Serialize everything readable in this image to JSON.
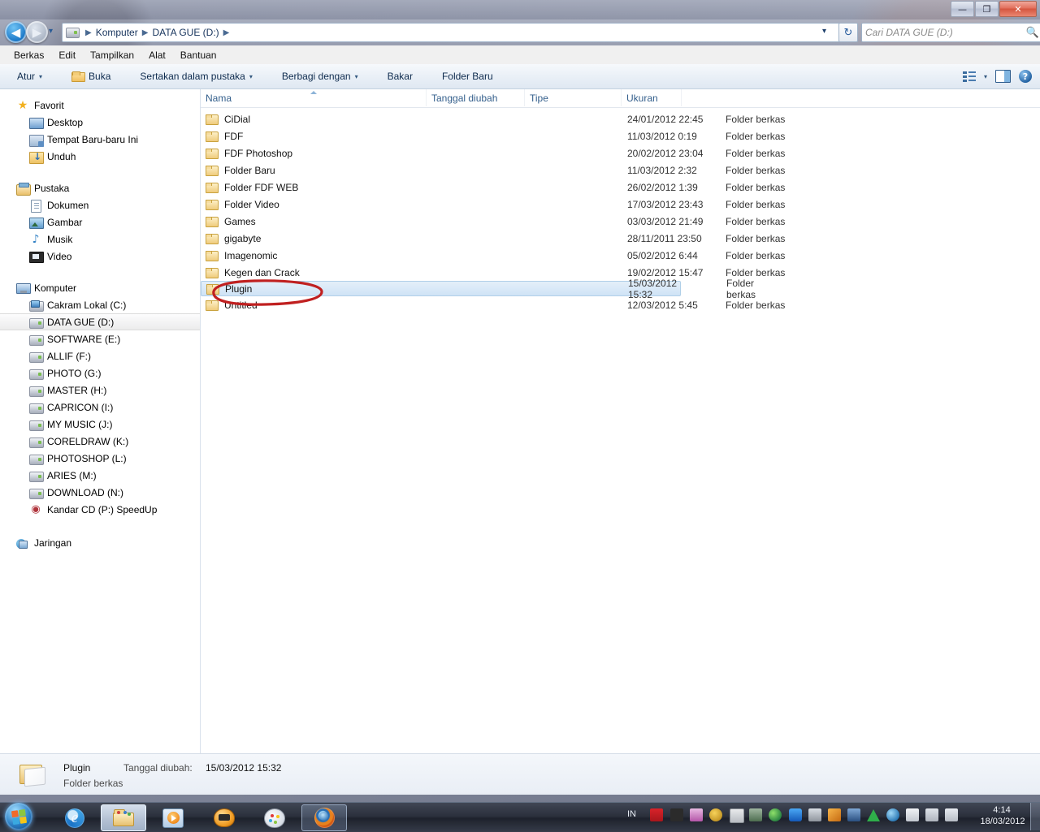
{
  "window": {
    "title_bar_buttons": {
      "minimize": "—",
      "maximize": "❐",
      "close": "✕"
    }
  },
  "address_bar": {
    "back_glyph": "◀",
    "forward_glyph": "▶",
    "history_glyph": "▾",
    "refresh_glyph": "↻",
    "crumb_separator": "▶",
    "breadcrumbs": [
      "Komputer",
      "DATA GUE (D:)"
    ],
    "drive_icon": "drive-icon"
  },
  "search": {
    "placeholder": "Cari DATA GUE (D:)",
    "icon": "search-icon",
    "glyph": "🔍"
  },
  "menu": {
    "items": [
      "Berkas",
      "Edit",
      "Tampilkan",
      "Alat",
      "Bantuan"
    ]
  },
  "command_bar": {
    "organize": "Atur",
    "open": "Buka",
    "include_library": "Sertakan dalam pustaka",
    "share_with": "Berbagi dengan",
    "burn": "Bakar",
    "new_folder": "Folder Baru",
    "caret": "▾",
    "view_icon": "view-options-icon",
    "preview_pane_icon": "preview-pane-icon",
    "help_icon": "help-icon",
    "help_glyph": "?"
  },
  "sidebar": {
    "groups": [
      {
        "name": "Favorit",
        "icon": "star-icon",
        "glyph": "★",
        "items": [
          {
            "label": "Desktop",
            "icon": "desktop-icon"
          },
          {
            "label": "Tempat Baru-baru Ini",
            "icon": "recent-places-icon"
          },
          {
            "label": "Unduh",
            "icon": "downloads-icon"
          }
        ]
      },
      {
        "name": "Pustaka",
        "icon": "library-icon",
        "items": [
          {
            "label": "Dokumen",
            "icon": "documents-icon"
          },
          {
            "label": "Gambar",
            "icon": "pictures-icon"
          },
          {
            "label": "Musik",
            "icon": "music-icon",
            "glyph": "♪"
          },
          {
            "label": "Video",
            "icon": "video-icon"
          }
        ]
      },
      {
        "name": "Komputer",
        "icon": "computer-icon",
        "items": [
          {
            "label": "Cakram Lokal (C:)",
            "icon": "system-drive-icon",
            "selected": false
          },
          {
            "label": "DATA GUE (D:)",
            "icon": "drive-icon",
            "selected": true
          },
          {
            "label": "SOFTWARE (E:)",
            "icon": "drive-icon",
            "selected": false
          },
          {
            "label": "ALLIF (F:)",
            "icon": "drive-icon",
            "selected": false
          },
          {
            "label": "PHOTO (G:)",
            "icon": "drive-icon",
            "selected": false
          },
          {
            "label": "MASTER (H:)",
            "icon": "drive-icon",
            "selected": false
          },
          {
            "label": "CAPRICON (I:)",
            "icon": "drive-icon",
            "selected": false
          },
          {
            "label": "MY MUSIC (J:)",
            "icon": "drive-icon",
            "selected": false
          },
          {
            "label": "CORELDRAW (K:)",
            "icon": "drive-icon",
            "selected": false
          },
          {
            "label": "PHOTOSHOP (L:)",
            "icon": "drive-icon",
            "selected": false
          },
          {
            "label": "ARIES (M:)",
            "icon": "drive-icon",
            "selected": false
          },
          {
            "label": "DOWNLOAD (N:)",
            "icon": "drive-icon",
            "selected": false
          },
          {
            "label": "Kandar CD (P:)  SpeedUp",
            "icon": "cd-drive-icon",
            "glyph": "◉"
          }
        ]
      },
      {
        "name": "Jaringan",
        "icon": "network-icon",
        "items": []
      }
    ]
  },
  "file_list": {
    "columns": [
      "Nama",
      "Tanggal diubah",
      "Tipe",
      "Ukuran"
    ],
    "sort_column": "Nama",
    "sort_direction": "ascending",
    "rows": [
      {
        "name": "CiDial",
        "date": "24/01/2012 22:45",
        "type": "Folder berkas",
        "size": "",
        "selected": false
      },
      {
        "name": "FDF",
        "date": "11/03/2012 0:19",
        "type": "Folder berkas",
        "size": "",
        "selected": false
      },
      {
        "name": "FDF Photoshop",
        "date": "20/02/2012 23:04",
        "type": "Folder berkas",
        "size": "",
        "selected": false
      },
      {
        "name": "Folder Baru",
        "date": "11/03/2012 2:32",
        "type": "Folder berkas",
        "size": "",
        "selected": false
      },
      {
        "name": "Folder FDF  WEB",
        "date": "26/02/2012 1:39",
        "type": "Folder berkas",
        "size": "",
        "selected": false
      },
      {
        "name": "Folder Video",
        "date": "17/03/2012 23:43",
        "type": "Folder berkas",
        "size": "",
        "selected": false
      },
      {
        "name": "Games",
        "date": "03/03/2012 21:49",
        "type": "Folder berkas",
        "size": "",
        "selected": false
      },
      {
        "name": "gigabyte",
        "date": "28/11/2011 23:50",
        "type": "Folder berkas",
        "size": "",
        "selected": false
      },
      {
        "name": "Imagenomic",
        "date": "05/02/2012 6:44",
        "type": "Folder berkas",
        "size": "",
        "selected": false
      },
      {
        "name": "Kegen dan Crack",
        "date": "19/02/2012 15:47",
        "type": "Folder berkas",
        "size": "",
        "selected": false
      },
      {
        "name": "Plugin",
        "date": "15/03/2012 15:32",
        "type": "Folder berkas",
        "size": "",
        "selected": true
      },
      {
        "name": "Untitled",
        "date": "12/03/2012 5:45",
        "type": "Folder berkas",
        "size": "",
        "selected": false
      }
    ]
  },
  "annotation": {
    "shape": "red-ellipse",
    "color": "#c02020",
    "target": "Plugin"
  },
  "details_pane": {
    "name": "Plugin",
    "type": "Folder berkas",
    "date_label": "Tanggal diubah:",
    "date_value": "15/03/2012 15:32",
    "icon": "folder-icon"
  },
  "taskbar": {
    "start_icon": "windows-start-orb",
    "buttons": [
      {
        "name": "internet-explorer",
        "state": "plain"
      },
      {
        "name": "windows-explorer",
        "state": "active"
      },
      {
        "name": "media-player",
        "state": "plain"
      },
      {
        "name": "gom-player",
        "state": "plain"
      },
      {
        "name": "paint",
        "state": "plain"
      },
      {
        "name": "firefox",
        "state": "hl"
      }
    ],
    "language_indicator": "IN",
    "tray_icons": [
      "avira-icon",
      "clapperboard-icon",
      "onenote-icon",
      "bug-icon",
      "notepad-icon",
      "camera-icon",
      "globe-update-icon",
      "bluetooth-icon",
      "usb-safely-remove-icon",
      "lightning-icon",
      "display-icon",
      "green-triangle-icon",
      "blue-globe-icon",
      "flag-error-icon",
      "network-icon",
      "volume-icon"
    ],
    "clock_time": "4:14",
    "clock_date": "18/03/2012",
    "show_desktop": "show-desktop-button"
  },
  "colors": {
    "accent": "#2b7fc4",
    "selection": "#cfe3f6",
    "annotation_red": "#c02020",
    "header_text": "#345f8c"
  }
}
